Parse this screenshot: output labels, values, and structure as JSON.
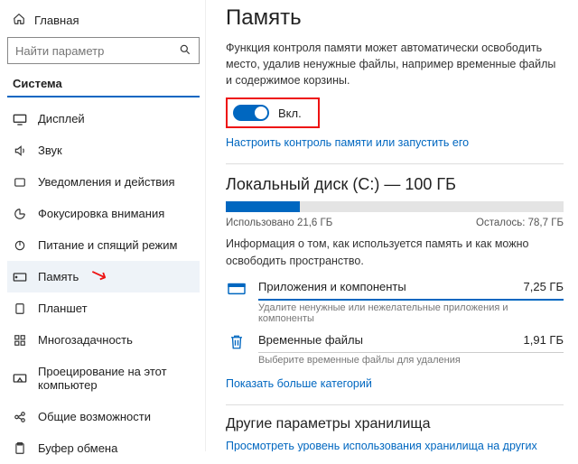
{
  "sidebar": {
    "home": "Главная",
    "search_placeholder": "Найти параметр",
    "section": "Система",
    "items": [
      {
        "label": "Дисплей"
      },
      {
        "label": "Звук"
      },
      {
        "label": "Уведомления и действия"
      },
      {
        "label": "Фокусировка внимания"
      },
      {
        "label": "Питание и спящий режим"
      },
      {
        "label": "Память"
      },
      {
        "label": "Планшет"
      },
      {
        "label": "Многозадачность"
      },
      {
        "label": "Проецирование на этот компьютер"
      },
      {
        "label": "Общие возможности"
      },
      {
        "label": "Буфер обмена"
      }
    ]
  },
  "main": {
    "title": "Память",
    "intro": "Функция контроля памяти может автоматически освободить место, удалив ненужные файлы, например временные файлы и содержимое корзины.",
    "toggle_label": "Вкл.",
    "configure_link": "Настроить контроль памяти или запустить его",
    "disk": {
      "heading": "Локальный диск (C:) — 100 ГБ",
      "used_pct": 22,
      "used_label": "Использовано 21,6 ГБ",
      "free_label": "Осталось: 78,7 ГБ",
      "info": "Информация о том, как используется память и как можно освободить пространство."
    },
    "categories": [
      {
        "name": "Приложения и компоненты",
        "size": "7,25 ГБ",
        "sub": "Удалите ненужные или нежелательные приложения и компоненты"
      },
      {
        "name": "Временные файлы",
        "size": "1,91 ГБ",
        "sub": "Выберите временные файлы для удаления"
      }
    ],
    "show_more": "Показать больше категорий",
    "other_heading": "Другие параметры хранилища",
    "other_link": "Просмотреть уровень использования хранилища на других дисках"
  }
}
